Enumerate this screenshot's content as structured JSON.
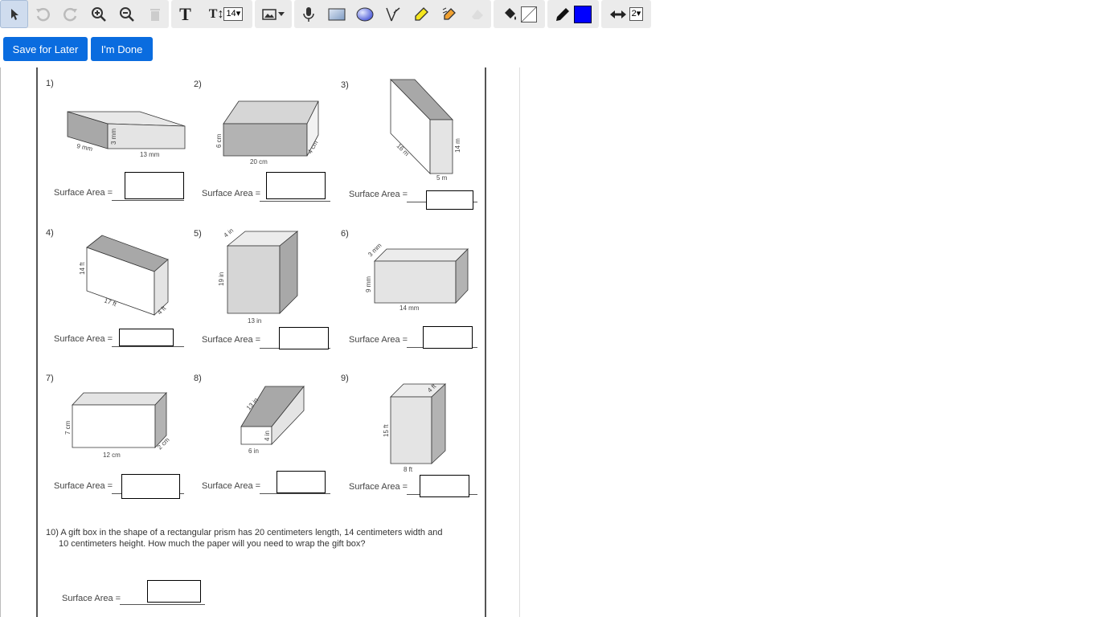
{
  "toolbar": {
    "text_size": "14",
    "line_width": "2",
    "draw_color": "#0000ff"
  },
  "buttons": {
    "save_later": "Save for Later",
    "done": "I'm Done"
  },
  "problems": [
    {
      "num": "1)",
      "dims": [
        "9 mm",
        "3 mm",
        "13 mm"
      ]
    },
    {
      "num": "2)",
      "dims": [
        "6 cm",
        "20 cm",
        "4 cm"
      ]
    },
    {
      "num": "3)",
      "dims": [
        "16 m",
        "14 m",
        "5 m"
      ]
    },
    {
      "num": "4)",
      "dims": [
        "14 ft",
        "17 ft",
        "4 ft"
      ]
    },
    {
      "num": "5)",
      "dims": [
        "4 in",
        "19 in",
        "13 in"
      ]
    },
    {
      "num": "6)",
      "dims": [
        "3 mm",
        "9 mm",
        "14 mm"
      ]
    },
    {
      "num": "7)",
      "dims": [
        "7 cm",
        "12 cm",
        "2 cm"
      ]
    },
    {
      "num": "8)",
      "dims": [
        "13 in",
        "4 in",
        "6 in"
      ]
    },
    {
      "num": "9)",
      "dims": [
        "15 ft",
        "4 ft",
        "8 ft"
      ]
    }
  ],
  "surface_area_label": "Surface Area =",
  "q10": {
    "num": "10)",
    "text_line1": "A gift box in the shape of a rectangular prism has 20 centimeters length, 14 centimeters width and",
    "text_line2": "10 centimeters height. How much the paper will you need to wrap the gift box?"
  }
}
